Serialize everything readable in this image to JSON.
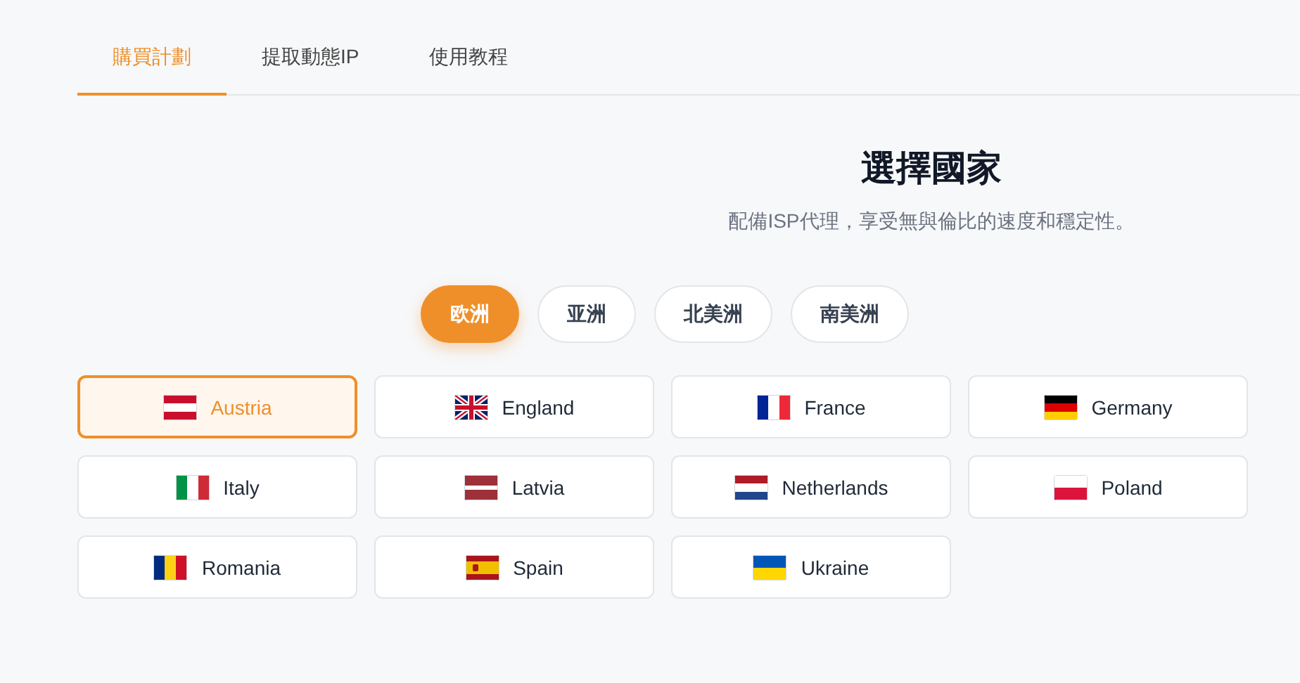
{
  "tabs": [
    {
      "label": "購買計劃",
      "selected": true
    },
    {
      "label": "提取動態IP",
      "selected": false
    },
    {
      "label": "使用教程",
      "selected": false
    }
  ],
  "heading": {
    "title": "選擇國家",
    "subtitle": "配備ISP代理，享受無與倫比的速度和穩定性。"
  },
  "regions": [
    {
      "label": "欧洲",
      "selected": true
    },
    {
      "label": "亚洲",
      "selected": false
    },
    {
      "label": "北美洲",
      "selected": false
    },
    {
      "label": "南美洲",
      "selected": false
    }
  ],
  "countries": [
    {
      "name": "Austria",
      "kind": "austria",
      "selected": true
    },
    {
      "name": "England",
      "kind": "uk",
      "selected": false
    },
    {
      "name": "France",
      "kind": "france",
      "selected": false
    },
    {
      "name": "Germany",
      "kind": "germany",
      "selected": false
    },
    {
      "name": "Italy",
      "kind": "italy",
      "selected": false
    },
    {
      "name": "Latvia",
      "kind": "latvia",
      "selected": false
    },
    {
      "name": "Netherlands",
      "kind": "netherlands",
      "selected": false
    },
    {
      "name": "Poland",
      "kind": "poland",
      "selected": false
    },
    {
      "name": "Romania",
      "kind": "romania",
      "selected": false
    },
    {
      "name": "Spain",
      "kind": "spain",
      "selected": false
    },
    {
      "name": "Ukraine",
      "kind": "ukraine",
      "selected": false
    }
  ]
}
